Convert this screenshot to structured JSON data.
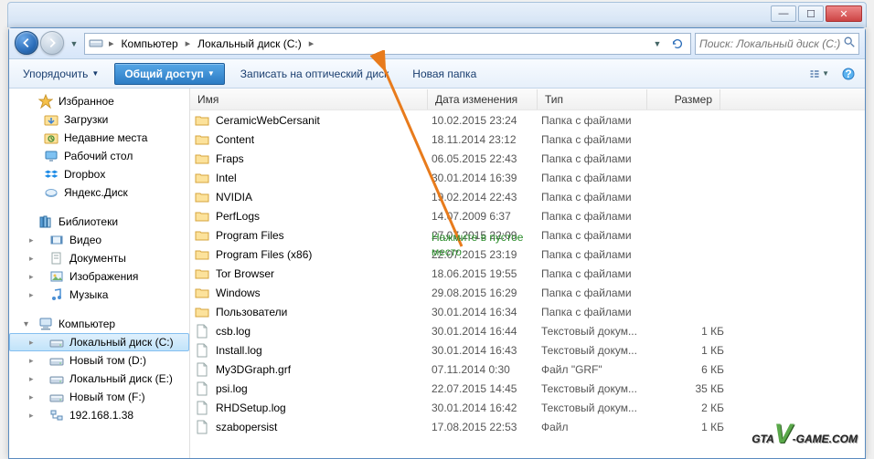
{
  "breadcrumbs": {
    "seg1": "Компьютер",
    "seg2": "Локальный диск (C:)"
  },
  "search": {
    "placeholder": "Поиск: Локальный диск (C:)"
  },
  "toolbar": {
    "organize": "Упорядочить",
    "share": "Общий доступ",
    "burn": "Записать на оптический диск",
    "new_folder": "Новая папка"
  },
  "nav": {
    "favorites": {
      "label": "Избранное"
    },
    "fav_items": [
      {
        "label": "Загрузки",
        "icon": "downloads"
      },
      {
        "label": "Недавние места",
        "icon": "recent"
      },
      {
        "label": "Рабочий стол",
        "icon": "desktop"
      },
      {
        "label": "Dropbox",
        "icon": "dropbox"
      },
      {
        "label": "Яндекс.Диск",
        "icon": "yadisk"
      }
    ],
    "libraries": {
      "label": "Библиотеки"
    },
    "lib_items": [
      {
        "label": "Видео",
        "icon": "video"
      },
      {
        "label": "Документы",
        "icon": "docs"
      },
      {
        "label": "Изображения",
        "icon": "pics"
      },
      {
        "label": "Музыка",
        "icon": "music"
      }
    ],
    "computer": {
      "label": "Компьютер"
    },
    "comp_items": [
      {
        "label": "Локальный диск (C:)",
        "icon": "hdd",
        "selected": true
      },
      {
        "label": "Новый том (D:)",
        "icon": "hdd"
      },
      {
        "label": "Локальный диск (E:)",
        "icon": "hdd"
      },
      {
        "label": "Новый том (F:)",
        "icon": "hdd"
      },
      {
        "label": "192.168.1.38",
        "icon": "network"
      }
    ]
  },
  "columns": {
    "name": "Имя",
    "date": "Дата изменения",
    "type": "Тип",
    "size": "Размер"
  },
  "files": [
    {
      "name": "CeramicWebCersanit",
      "date": "10.02.2015 23:24",
      "type": "Папка с файлами",
      "size": "",
      "kind": "folder"
    },
    {
      "name": "Content",
      "date": "18.11.2014 23:12",
      "type": "Папка с файлами",
      "size": "",
      "kind": "folder"
    },
    {
      "name": "Fraps",
      "date": "06.05.2015 22:43",
      "type": "Папка с файлами",
      "size": "",
      "kind": "folder"
    },
    {
      "name": "Intel",
      "date": "30.01.2014 16:39",
      "type": "Папка с файлами",
      "size": "",
      "kind": "folder"
    },
    {
      "name": "NVIDIA",
      "date": "19.02.2014 22:43",
      "type": "Папка с файлами",
      "size": "",
      "kind": "folder"
    },
    {
      "name": "PerfLogs",
      "date": "14.07.2009 6:37",
      "type": "Папка с файлами",
      "size": "",
      "kind": "folder"
    },
    {
      "name": "Program Files",
      "date": "27.07.2015 22:09",
      "type": "Папка с файлами",
      "size": "",
      "kind": "folder"
    },
    {
      "name": "Program Files (x86)",
      "date": "22.07.2015 23:19",
      "type": "Папка с файлами",
      "size": "",
      "kind": "folder"
    },
    {
      "name": "Tor Browser",
      "date": "18.06.2015 19:55",
      "type": "Папка с файлами",
      "size": "",
      "kind": "folder"
    },
    {
      "name": "Windows",
      "date": "29.08.2015 16:29",
      "type": "Папка с файлами",
      "size": "",
      "kind": "folder"
    },
    {
      "name": "Пользователи",
      "date": "30.01.2014 16:34",
      "type": "Папка с файлами",
      "size": "",
      "kind": "folder"
    },
    {
      "name": "csb.log",
      "date": "30.01.2014 16:44",
      "type": "Текстовый докум...",
      "size": "1 КБ",
      "kind": "file"
    },
    {
      "name": "Install.log",
      "date": "30.01.2014 16:43",
      "type": "Текстовый докум...",
      "size": "1 КБ",
      "kind": "file"
    },
    {
      "name": "My3DGraph.grf",
      "date": "07.11.2014 0:30",
      "type": "Файл \"GRF\"",
      "size": "6 КБ",
      "kind": "file"
    },
    {
      "name": "psi.log",
      "date": "22.07.2015 14:45",
      "type": "Текстовый докум...",
      "size": "35 КБ",
      "kind": "file"
    },
    {
      "name": "RHDSetup.log",
      "date": "30.01.2014 16:42",
      "type": "Текстовый докум...",
      "size": "2 КБ",
      "kind": "file"
    },
    {
      "name": "szabopersist",
      "date": "17.08.2015 22:53",
      "type": "Файл",
      "size": "1 КБ",
      "kind": "file"
    }
  ],
  "annotation": {
    "line1": "Нажмите в пустое",
    "line2": "место"
  },
  "watermark": {
    "p1": "GTA",
    "p2": "V",
    "p3": "-GAME",
    "p4": ".COM"
  }
}
